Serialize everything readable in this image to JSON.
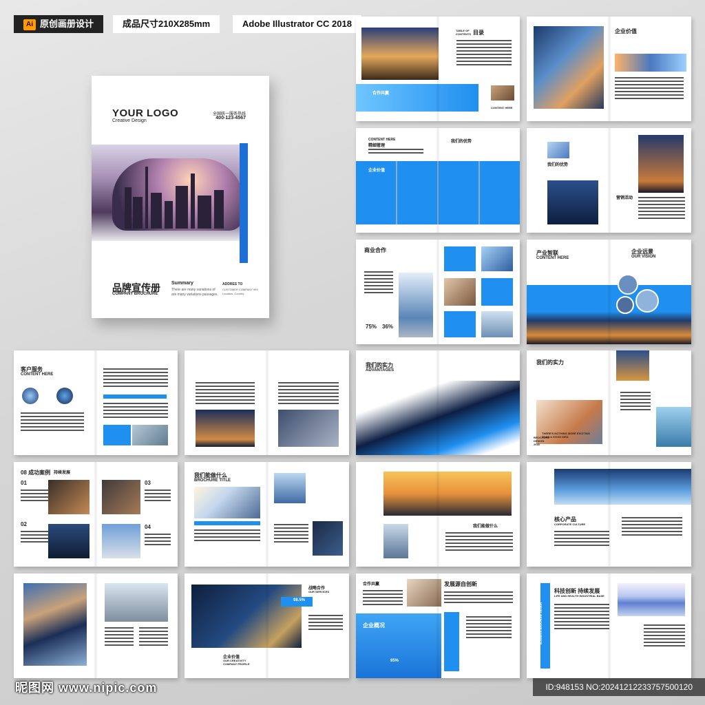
{
  "tags": {
    "original": "原创画册设计",
    "size": "成品尺寸210X285mm",
    "software": "Adobe Illustrator CC 2018",
    "ai_badge": "Ai"
  },
  "cover": {
    "logo": "YOUR LOGO",
    "logo_sub": "Creative Design",
    "hotline": "全国统一服务热线",
    "phone": "400-123-4567",
    "title": "品牌宣传册",
    "title_en": "COMPANY BROCHURE",
    "summary": "Summary",
    "summary_text": "There are many variations of  are many variations passages.",
    "address": "ADDRES TO",
    "address_text": "CUSTOMER COMPANY 999 Location, Country"
  },
  "spreads": {
    "toc_title": "目录",
    "toc_sub": "TABLE OF CONTENTS",
    "cooperation": "合作共赢",
    "content_here": "CONTENT HERE",
    "enterprise_value": "企业价值",
    "refined_mgmt": "精细管理",
    "our_advantage": "我们的优势",
    "enterprise_value_blue": "企业价值",
    "marketing": "营销活动",
    "business_coop": "商业合作",
    "pct_a": "75%",
    "pct_b": "36%",
    "industry_brain": "产业智联",
    "vision": "企业远景",
    "our_vision": "OUR VISION",
    "customer_service": "客户服务",
    "strength": "我们的实力",
    "advantages": "ADVANTAGES",
    "strength2": "我们的实力",
    "not_exciting": "THERE'S NOTHING MORE EXCITING THAN A GOOD IDEA",
    "brochure_design": "BROCHURE DESIGN 2035",
    "success": "08 成功案例",
    "build_dev": "持续发展",
    "num_01": "01",
    "num_02": "02",
    "num_03": "03",
    "num_04": "04",
    "what_we_do": "我们能做什么",
    "brochure_title": "BROCHURE TITLE",
    "core_product": "核心产品",
    "corporate_culture": "CORPORATE CULTURE",
    "what_we_do2": "我们能做什么",
    "strategic": "战略合作",
    "our_services": "OUR SERVICES",
    "pct_c": "98.5%",
    "enterprise_value3": "企业价值",
    "our_creativity": "OUR CREATIVITY COMPANY PROFILE",
    "cooperation2": "合作共赢",
    "dev_innovation": "发展源自创新",
    "overview": "企业概况",
    "pct_d": "95%",
    "tech_innovation": "科技创新 持续发展",
    "life_health": "LIFE AND HEALTH INDUSTRIAL BASE",
    "business_brochure": "BUSINESS BROCHURE DESIGN"
  },
  "footer": {
    "site": "昵图网 www.nipic.com",
    "id": "ID:948153 NO:20241212233757500120"
  }
}
